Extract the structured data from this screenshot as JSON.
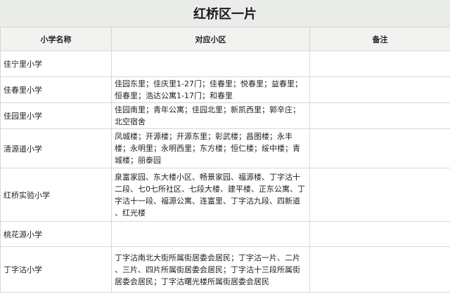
{
  "title": "红桥区一片",
  "columns": [
    "小学名称",
    "对应小区",
    "备注"
  ],
  "rows": [
    {
      "school": "佳宁里小学",
      "estates": [
        "",
        ""
      ],
      "remark": ""
    },
    {
      "school": "佳春里小学",
      "estates": [
        "佳园东里；佳庆里1-27门；佳春里；悦春里；益春里；",
        "恒春里；浩达公寓1-17门；和春里"
      ],
      "remark": ""
    },
    {
      "school": "佳园里小学",
      "estates": [
        "佳园南里；青年公寓；佳园北里；新凯西里；郭辛庄；",
        "北空宿舍"
      ],
      "remark": ""
    },
    {
      "school": "清源道小学",
      "estates": [
        "凤城楼；开源楼；开源东里；彰武楼；昌图楼；永丰",
        "楼；永明里；永明西里；东方楼；恒仁楼；绥中楼；青",
        "城楼；丽泰园"
      ],
      "remark": ""
    },
    {
      "school": "红桥实验小学",
      "estates": [
        "泉富家园、东大楼小区、畅景家园、福源楼、丁字沽十",
        "二段、七0七所社区、七段大楼、建平楼、正东公寓、丁",
        "字沽十一段、福源公寓、连富里、丁字沽九段、四新道",
        "、红光楼"
      ],
      "remark": ""
    },
    {
      "school": "桃花源小学",
      "estates": [
        "",
        ""
      ],
      "remark": ""
    },
    {
      "school": "丁字沽小学",
      "estates": [
        "丁字沽南北大街所属街居委会居民；丁字沽一片、二片",
        "、三片、四片所属街居委会居民；丁字沽十三段所属街",
        "居委会居民；丁字沽曙光楼所属街居委会居民"
      ],
      "remark": ""
    }
  ]
}
